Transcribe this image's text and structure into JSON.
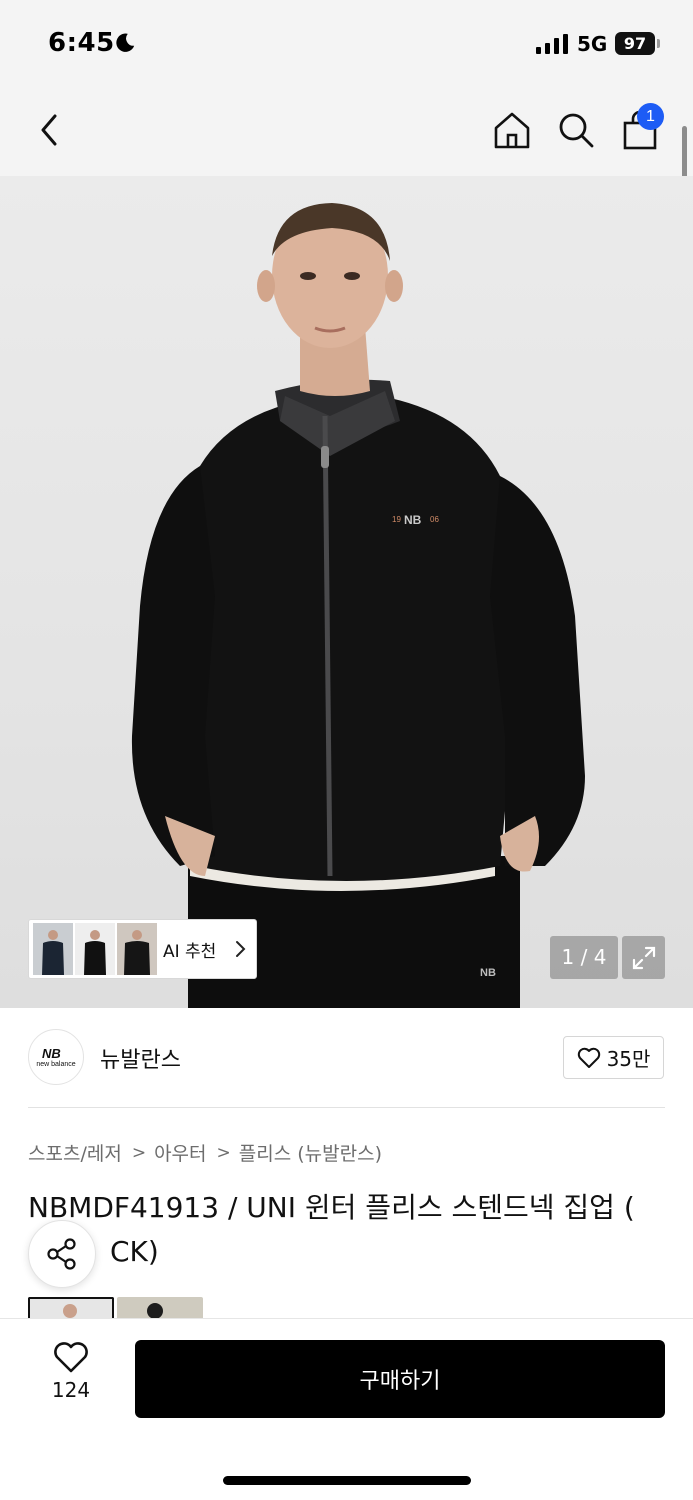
{
  "status_bar": {
    "time": "6:45",
    "network": "5G",
    "battery": "97"
  },
  "nav": {
    "cart_count": "1",
    "icons": [
      "back-arrow-icon",
      "home-icon",
      "search-icon",
      "shopping-bag-icon"
    ]
  },
  "gallery": {
    "ai_label": "AI 추천",
    "pager": "1 / 4",
    "logo_mark_text": "19 NB 06"
  },
  "brand": {
    "name": "뉴발란스",
    "logo_text": "new balance",
    "likes": "35만"
  },
  "breadcrumb": [
    "스포츠/레저",
    "아우터",
    "플리스 (뉴발란스)"
  ],
  "product": {
    "title": "NBMDF41913 / UNI 윈터 플리스 스텐드넥 집업 (",
    "title_line2": "CK)"
  },
  "bottom_bar": {
    "wish_count": "124",
    "buy_label": "구매하기"
  },
  "colors": {
    "badge_blue": "#1d5cf5",
    "buy_button": "#000000",
    "header_bg": "#f4f4f4"
  }
}
